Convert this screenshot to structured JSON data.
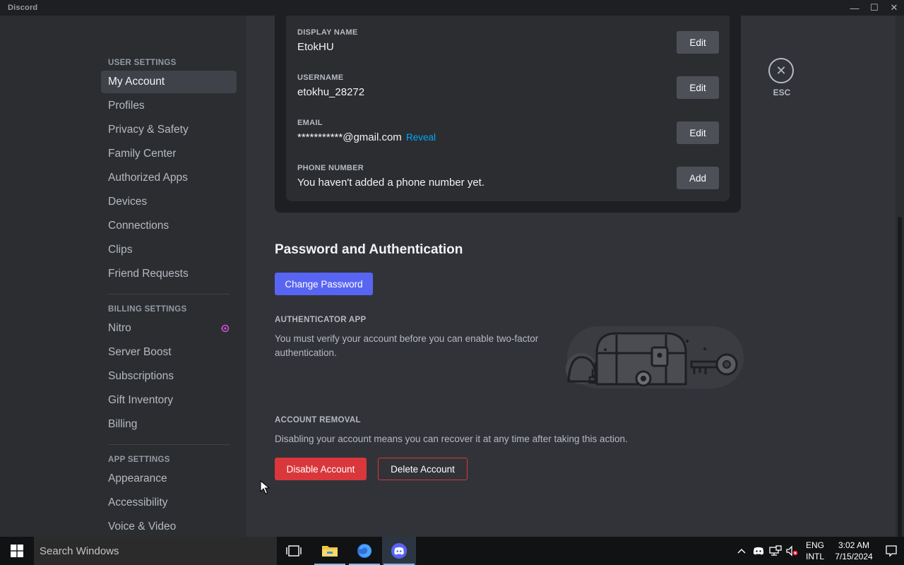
{
  "window": {
    "app_name": "Discord"
  },
  "sidebar": {
    "user_settings_header": "USER SETTINGS",
    "user_items": [
      "My Account",
      "Profiles",
      "Privacy & Safety",
      "Family Center",
      "Authorized Apps",
      "Devices",
      "Connections",
      "Clips",
      "Friend Requests"
    ],
    "billing_settings_header": "BILLING SETTINGS",
    "billing_items": [
      "Nitro",
      "Server Boost",
      "Subscriptions",
      "Gift Inventory",
      "Billing"
    ],
    "app_settings_header": "APP SETTINGS",
    "app_items": [
      "Appearance",
      "Accessibility",
      "Voice & Video"
    ],
    "active_item": "My Account"
  },
  "account": {
    "display_name": {
      "label": "DISPLAY NAME",
      "value": "EtokHU",
      "button": "Edit"
    },
    "username": {
      "label": "USERNAME",
      "value": "etokhu_28272",
      "button": "Edit"
    },
    "email": {
      "label": "EMAIL",
      "value": "***********@gmail.com",
      "reveal": "Reveal",
      "button": "Edit"
    },
    "phone": {
      "label": "PHONE NUMBER",
      "value": "You haven't added a phone number yet.",
      "button": "Add"
    }
  },
  "close": {
    "label": "ESC"
  },
  "password": {
    "title": "Password and Authentication",
    "change_button": "Change Password",
    "authenticator_header": "AUTHENTICATOR APP",
    "authenticator_desc_1": "You must verify your account before you can enable two-factor",
    "authenticator_desc_2": "authentication."
  },
  "removal": {
    "header": "ACCOUNT REMOVAL",
    "desc": "Disabling your account means you can recover it at any time after taking this action.",
    "disable_button": "Disable Account",
    "delete_button": "Delete Account"
  },
  "taskbar": {
    "search_placeholder": "Search Windows",
    "lang_1": "ENG",
    "lang_2": "INTL",
    "time": "3:02 AM",
    "date": "7/15/2024"
  },
  "colors": {
    "accent": "#5865f2",
    "danger": "#da373c",
    "link": "#00a8fc",
    "nitro": "#d04fd8"
  }
}
